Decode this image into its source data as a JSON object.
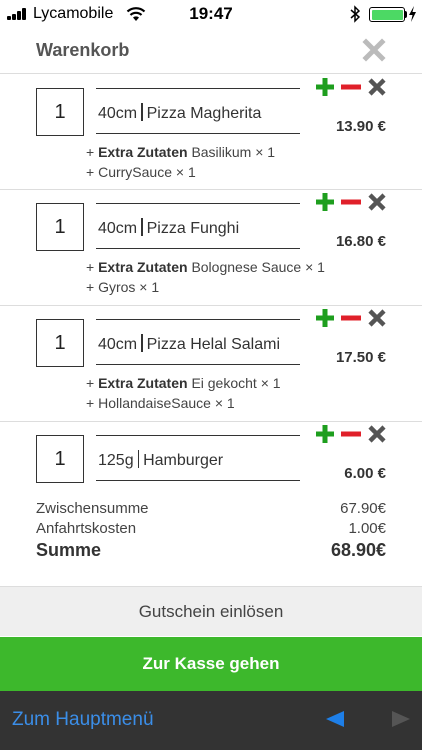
{
  "status_bar": {
    "carrier": "Lycamobile",
    "time": "19:47",
    "battery_level": 1.0
  },
  "header": {
    "title": "Warenkorb"
  },
  "items": [
    {
      "qty": "1",
      "size": "40cm",
      "name": "Pizza Magherita",
      "price": "13.90 €",
      "extras_label": "Extra Zutaten",
      "extras_first": "Basilikum × 1",
      "extras_second": "CurrySauce × 1"
    },
    {
      "qty": "1",
      "size": "40cm",
      "name": "Pizza Funghi",
      "price": "16.80 €",
      "extras_label": "Extra Zutaten",
      "extras_first": "Bolognese Sauce × 1",
      "extras_second": "Gyros × 1"
    },
    {
      "qty": "1",
      "size": "40cm",
      "name": "Pizza Helal Salami",
      "price": "17.50 €",
      "extras_label": "Extra Zutaten",
      "extras_first": "Ei gekocht × 1",
      "extras_second": "HollandaiseSauce × 1"
    },
    {
      "qty": "1",
      "size": "125g",
      "name": "Hamburger",
      "price": "6.00 €"
    }
  ],
  "summary": {
    "subtotal_label": "Zwischensumme",
    "subtotal_value": "67.90€",
    "delivery_label": "Anfahrtskosten",
    "delivery_value": "1.00€",
    "total_label": "Summe",
    "total_value": "68.90€"
  },
  "voucher_label": "Gutschein einlösen",
  "checkout_label": "Zur Kasse gehen",
  "bottom_nav": {
    "back_label": "Zum Hauptmenü"
  },
  "colors": {
    "add": "#1e9e1e",
    "remove": "#e0202a",
    "delete": "#555555",
    "checkout": "#3db82c",
    "link": "#3b8ee8",
    "nav_active": "#1e7fe8",
    "nav_inactive": "#555555"
  },
  "icons": {
    "plus": "plus-icon",
    "minus": "minus-icon",
    "remove": "close-icon",
    "prev": "triangle-left-icon",
    "next": "triangle-right-icon"
  }
}
